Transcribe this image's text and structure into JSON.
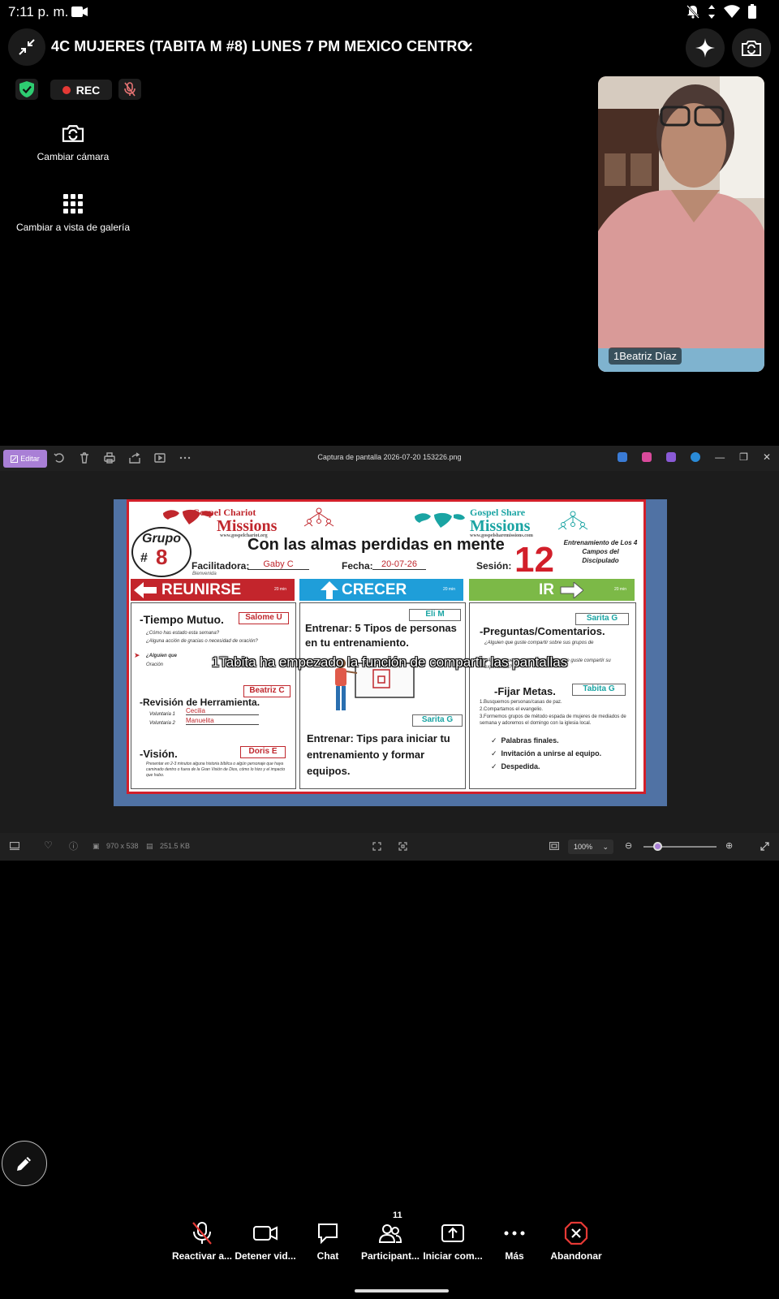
{
  "status_bar": {
    "time": "7:11 p. m."
  },
  "meeting": {
    "title": "4C MUJERES (TABITA M #8) LUNES 7 PM MEXICO CENTRO.",
    "rec_label": "REC",
    "actions": {
      "switch_camera": "Cambiar cámara",
      "gallery_view": "Cambiar a vista de galería"
    },
    "participant": {
      "name": "1Beatriz Díaz"
    }
  },
  "viewer": {
    "edit_label": "Editar",
    "file_title": "Captura de pantalla 2026-07-20 153226.png",
    "dimensions": "970 x 538",
    "file_size": "251.5 KB",
    "zoom": "100%"
  },
  "slide": {
    "logo_left": {
      "line1": "Gospel Chariot",
      "line2": "Missions",
      "url": "www.gospelchariot.org"
    },
    "logo_right": {
      "line1": "Gospel Share",
      "line2": "Missions",
      "url": "www.gospelsharemissions.com"
    },
    "grupo_word": "Grupo",
    "grupo_hash": "#",
    "grupo_number": "8",
    "title": "Con las almas perdidas en mente",
    "session_number": "12",
    "session_label": "Sesión:",
    "training_note": "Entrenamiento de Los 4 Campos del Discipulado",
    "facilitator_label": "Facilitadora:",
    "facilitator_value": "Gaby C",
    "welcome": "Bienvenida",
    "date_label": "Fecha:",
    "date_value": "20-07-26",
    "banners": {
      "reunirse": "REUNIRSE",
      "crecer": "CRECER",
      "ir": "IR",
      "minutes": "20 min"
    },
    "col1": {
      "tag1": "Salome U",
      "heading1": "-Tiempo Mutuo.",
      "items": [
        "¿Cómo has estado esta semana?",
        "¿Alguna acción de gracias o necesidad de oración?",
        "¿Alguien que",
        "Oración"
      ],
      "tag2": "Beatriz C",
      "heading2": "-Revisión de Herramienta.",
      "vol1_label": "Voluntaria 1",
      "vol1_name": "Cecilia",
      "vol2_label": "Voluntaria 2",
      "vol2_name": "Manuelita",
      "tag3": "Doris E",
      "heading3": "-Visión.",
      "vision_text": "Presentar en 2-3 minutos alguna historia bíblica o algún personaje que haya caminado dentro o fuera de la Gran Visión de Dios, cómo lo hizo y el impacto que hubo."
    },
    "col2": {
      "tag1": "Eli M",
      "heading1": "Entrenar: 5 Tipos de personas en tu entrenamiento.",
      "tag2": "Sarita G",
      "heading2": "Entrenar: Tips para iniciar tu entrenamiento y formar equipos."
    },
    "col3": {
      "tag1": "Sarita G",
      "heading1": "-Preguntas/Comentarios.",
      "q1": "¿Alguien que guste compartir sobre sus grupos de",
      "q2": "¿Alguien que ya este entrenando y que guste compartir su experiencia?",
      "tag2": "Tabita G",
      "heading2": "-Fijar Metas.",
      "goal1": "1.Busquemos personas/casas de paz.",
      "goal2": "2.Compartamos el evangelio.",
      "goal3": "3.Formemos grupos de método espada de mujeres de mediados de semana y adoremos el domingo con la iglesia local.",
      "checks": [
        "Palabras finales.",
        "Invitación a unirse al equipo.",
        "Despedida."
      ]
    }
  },
  "share_notice": "1Tabita ha empezado la función de compartir las pantallas",
  "toolbar": {
    "unmute": "Reactivar a...",
    "stop_video": "Detener vid...",
    "chat": "Chat",
    "participants": "Participant...",
    "participants_count": "11",
    "share": "Iniciar com...",
    "more": "Más",
    "leave": "Abandonar"
  },
  "colors": {
    "accent_purple": "#a97fd6",
    "rec_red": "#e53935",
    "leave_red": "#e53935",
    "shield_green": "#2ecc71",
    "slide_red": "#c3252c",
    "slide_blue": "#1f9ed9",
    "slide_green": "#7cb947"
  }
}
